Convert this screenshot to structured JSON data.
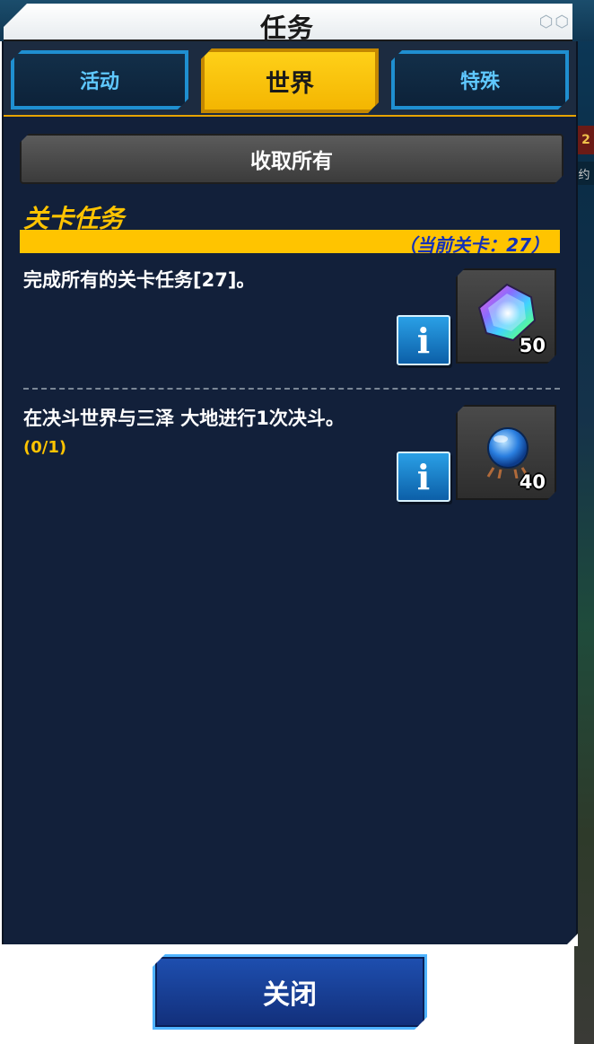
{
  "header": {
    "title": "任务"
  },
  "tabs": [
    {
      "label": "活动",
      "active": false
    },
    {
      "label": "世界",
      "active": true
    },
    {
      "label": "特殊",
      "active": false
    }
  ],
  "collect_all_label": "收取所有",
  "section": {
    "title": "关卡任务",
    "current_level_text": "（当前关卡：27）"
  },
  "missions": [
    {
      "description": "完成所有的关卡任务[27]。",
      "progress": "",
      "reward_icon": "rainbow-gem-icon",
      "reward_count": "50"
    },
    {
      "description": "在决斗世界与三泽 大地进行1次决斗。",
      "progress": "(0/1)",
      "reward_icon": "rare-orb-icon",
      "reward_count": "40"
    }
  ],
  "close_label": "关闭",
  "colors": {
    "accent_gold": "#ffc400",
    "panel_bg": "#12203a",
    "tab_blue": "#5fc8ff",
    "level_text": "#1330b8"
  },
  "background_peek": {
    "chip_text": "2",
    "chip2_text": "约"
  }
}
